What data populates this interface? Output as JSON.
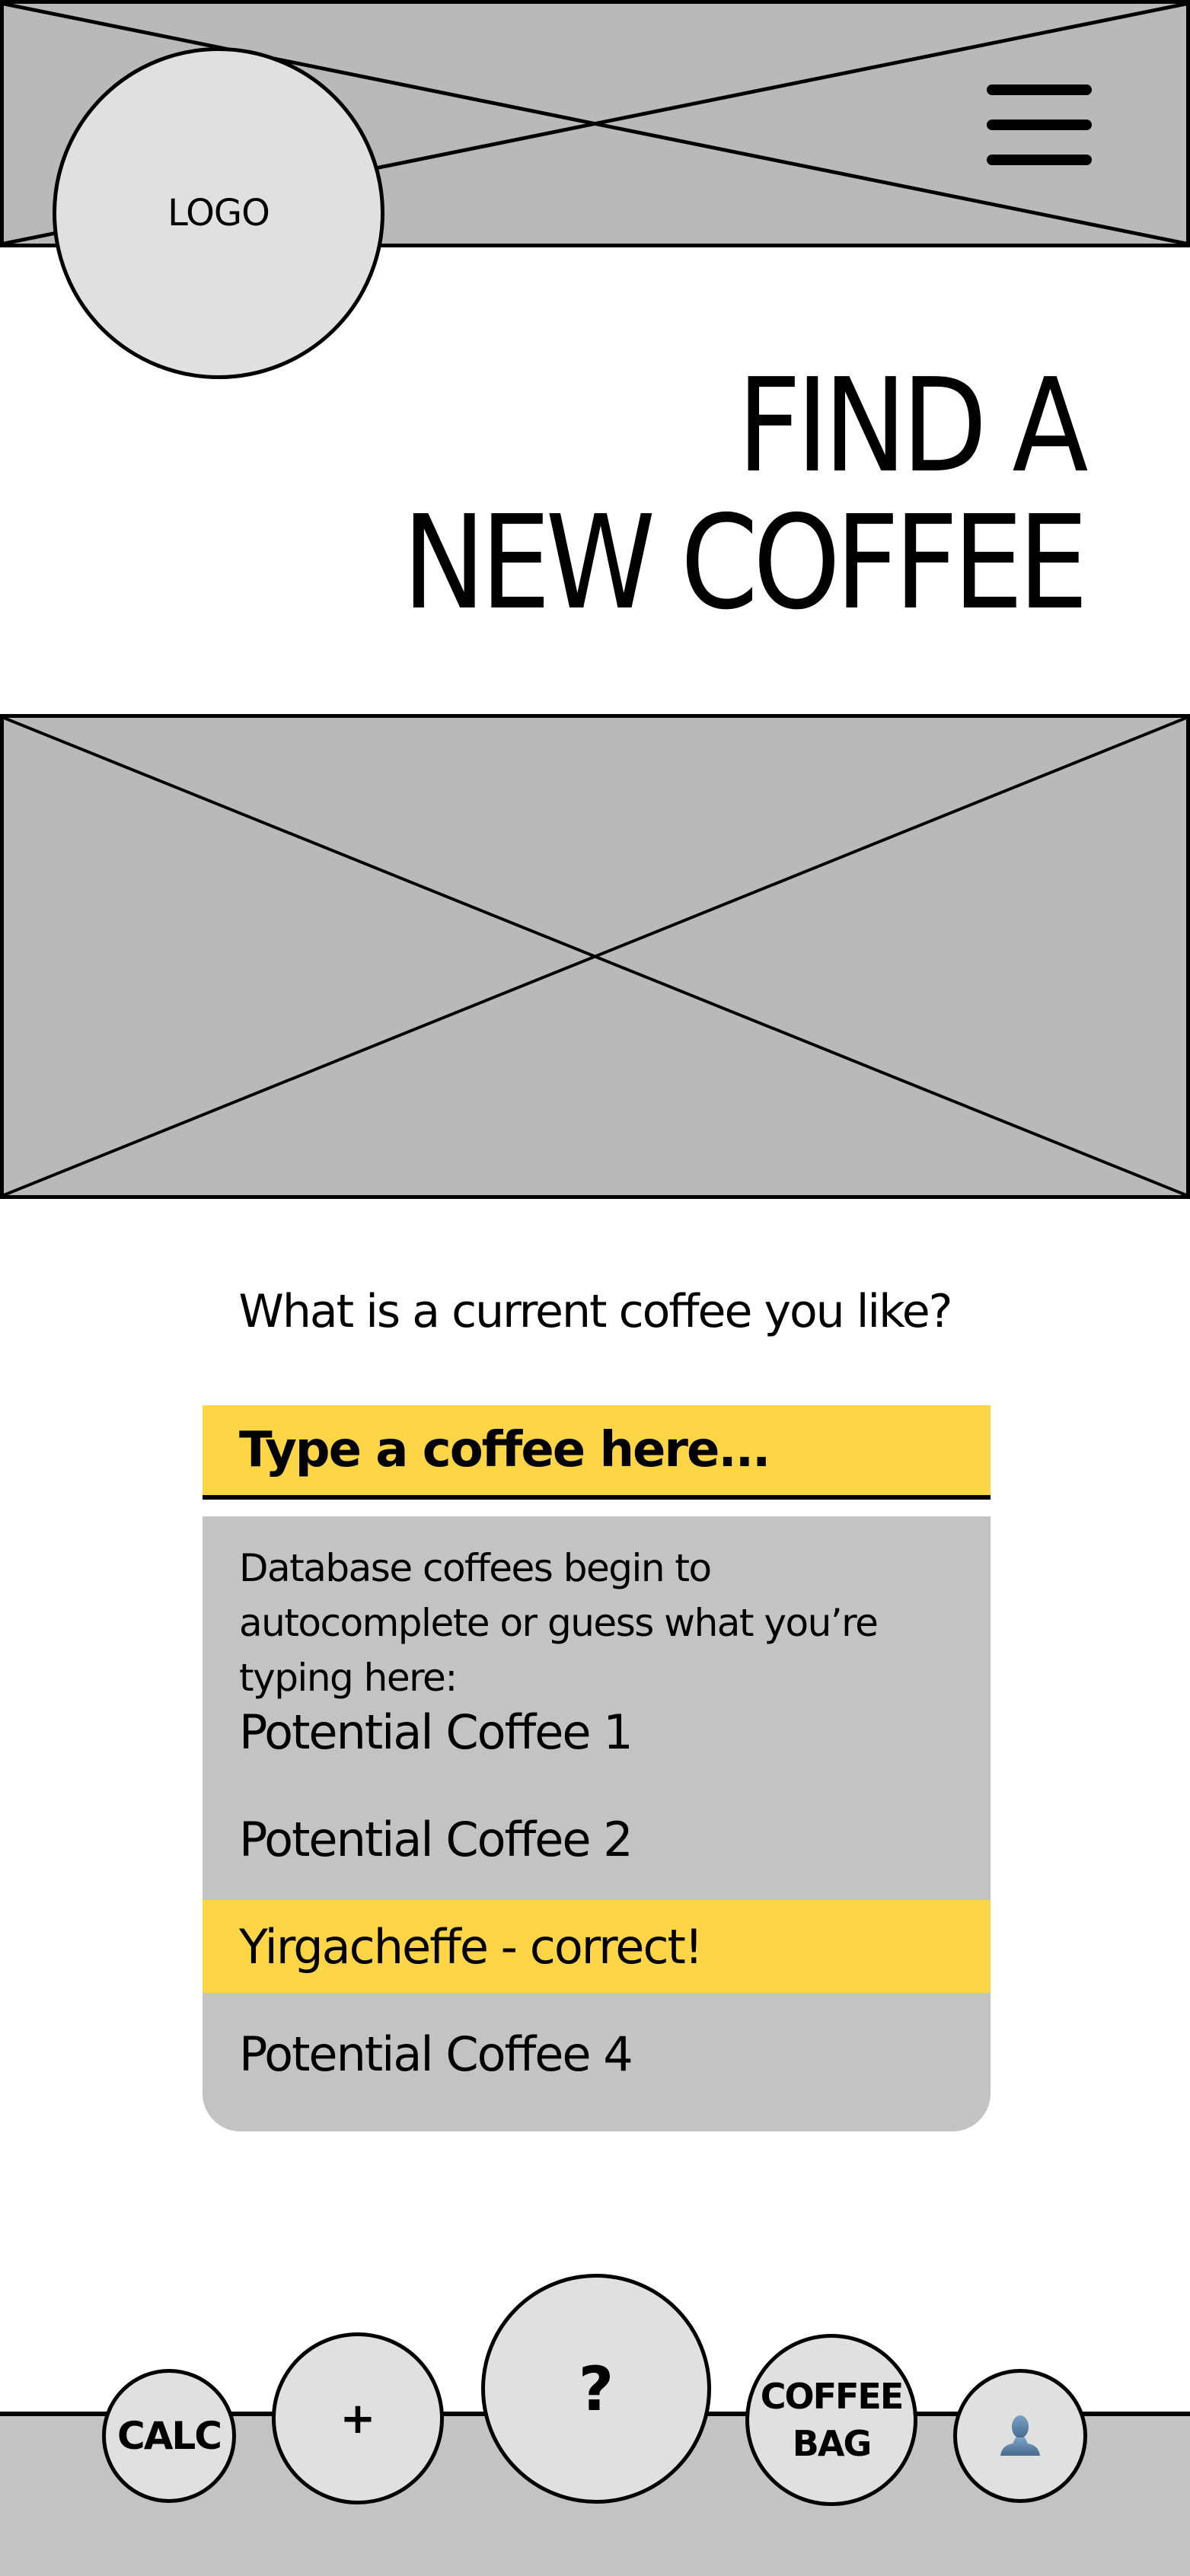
{
  "header": {
    "logo_label": "LOGO",
    "menu_icon": "hamburger-menu-icon"
  },
  "page_title": "FIND A\nNEW COFFEE",
  "hero": {
    "image_placeholder": "image-placeholder"
  },
  "search": {
    "question": "What is a current coffee you like?",
    "placeholder": "Type a coffee here...",
    "value": "",
    "dropdown_hint": "Database coffees begin to autocomplete or guess what you’re typing here:",
    "suggestions": [
      {
        "label": "Potential Coffee 1",
        "selected": false
      },
      {
        "label": "Potential Coffee 2",
        "selected": false
      },
      {
        "label": "Yirgacheffe - correct!",
        "selected": true
      },
      {
        "label": "Potential Coffee 4",
        "selected": false
      }
    ]
  },
  "bottom_nav": {
    "calc_label": "CALC",
    "add_label": "+",
    "help_label": "?",
    "coffee_bag_label": "COFFEE\nBAG",
    "profile_icon": "user-profile-icon"
  },
  "colors": {
    "accent_yellow": "#fed546",
    "placeholder_gray": "#b9b9b9",
    "panel_gray": "#c3c3c3",
    "button_gray": "#e0e0e0",
    "profile_icon_blue": "#5b84ad"
  }
}
